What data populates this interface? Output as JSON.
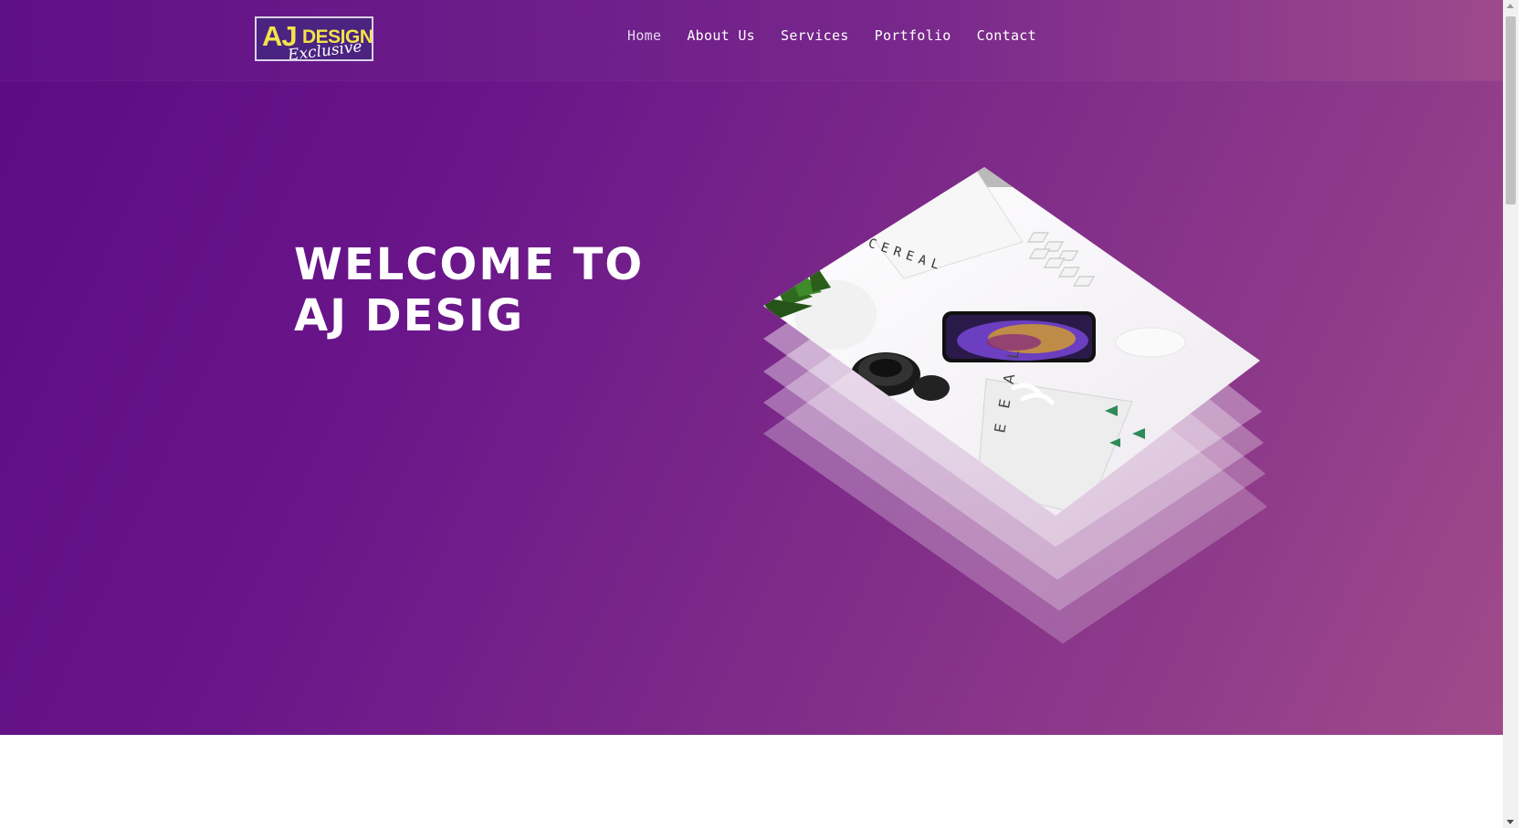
{
  "brand": {
    "logo_text_main": "AJ",
    "logo_text_design": "DESIGN",
    "logo_text_sub": "Exclusive",
    "logo_color": "#f2e34a"
  },
  "nav": {
    "items": [
      {
        "label": "Home",
        "active": true
      },
      {
        "label": "About Us",
        "active": false
      },
      {
        "label": "Services",
        "active": false
      },
      {
        "label": "Portfolio",
        "active": false
      },
      {
        "label": "Contact",
        "active": false
      }
    ]
  },
  "hero": {
    "title": "WELCOME TO AJ DESIG",
    "image_icon": "isometric-desk-photo-stack",
    "gradient_start": "#5c0b82",
    "gradient_end": "#a24b8a"
  }
}
